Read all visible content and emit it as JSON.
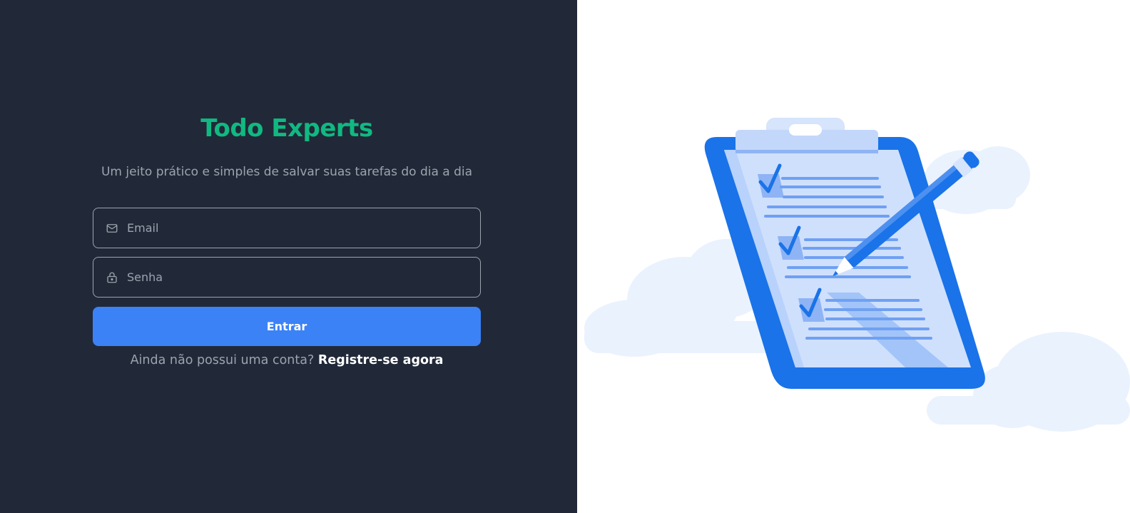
{
  "app": {
    "title": "Todo Experts",
    "subtitle": "Um jeito prático e simples de salvar suas tarefas do dia a dia"
  },
  "form": {
    "email": {
      "placeholder": "Email",
      "value": "",
      "icon": "mail-icon"
    },
    "password": {
      "placeholder": "Senha",
      "value": "",
      "icon": "lock-icon"
    },
    "submit_label": "Entrar"
  },
  "register": {
    "prompt": "Ainda não possui uma conta?",
    "link_label": "Registre-se agora"
  },
  "illustration": {
    "name": "clipboard-checklist-illustration"
  },
  "colors": {
    "panel_bg": "#212938",
    "brand": "#10b981",
    "primary": "#3b82f6",
    "muted_text": "#9ca3af",
    "illustration_blue": "#1a73e8"
  }
}
